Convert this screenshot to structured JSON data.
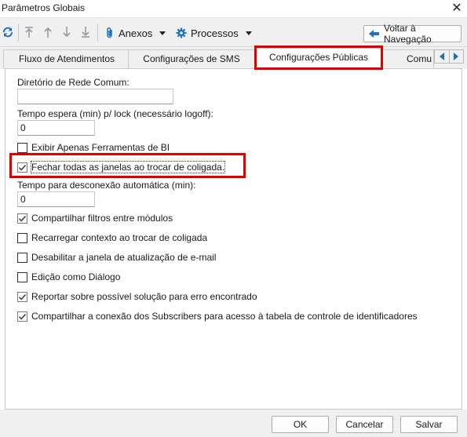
{
  "window": {
    "title": "Parâmetros Globais",
    "close_glyph": "✕"
  },
  "toolbar": {
    "icons": [
      "refresh-icon",
      "move-top-icon",
      "move-up-icon",
      "move-down-icon",
      "move-bottom-icon",
      "paperclip-icon",
      "gear-icon",
      "back-arrow-icon"
    ],
    "anexos_label": "Anexos",
    "processos_label": "Processos",
    "voltar_label": "Voltar à Navegação"
  },
  "tabs": [
    {
      "label": "Fluxo de Atendimentos",
      "active": false
    },
    {
      "label": "Configurações de SMS",
      "active": false
    },
    {
      "label": "Configurações Públicas",
      "active": true
    },
    {
      "label": "Comu",
      "active": false
    }
  ],
  "form": {
    "diretorio_label": "Diretório de Rede Comum:",
    "diretorio_value": "",
    "tempo_espera_label": "Tempo espera (min) p/ lock (necessário logoff):",
    "tempo_espera_value": "0",
    "tempo_desconexao_label": "Tempo para desconexão automática (min):",
    "tempo_desconexao_value": "0",
    "checkboxes": [
      {
        "label": "Exibir Apenas Ferramentas de BI",
        "checked": false
      },
      {
        "label": "Fechar todas as janelas ao trocar de coligada.",
        "checked": true,
        "focused": true
      },
      {
        "label": "Compartilhar filtros entre módulos",
        "checked": true
      },
      {
        "label": "Recarregar contexto ao trocar de coligada",
        "checked": false
      },
      {
        "label": "Desabilitar a janela de atualização de e-mail",
        "checked": false
      },
      {
        "label": "Edição como Diálogo",
        "checked": false
      },
      {
        "label": "Reportar sobre possível solução para erro encontrado",
        "checked": true
      },
      {
        "label": "Compartilhar a conexão dos Subscribers para acesso à tabela de controle de identificadores",
        "checked": true
      }
    ]
  },
  "footer": {
    "ok_label": "OK",
    "cancel_label": "Cancelar",
    "save_label": "Salvar"
  },
  "colors": {
    "highlight": "#e00000",
    "accent_blue": "#1e73be",
    "window_bg": "#f0f0f0"
  }
}
